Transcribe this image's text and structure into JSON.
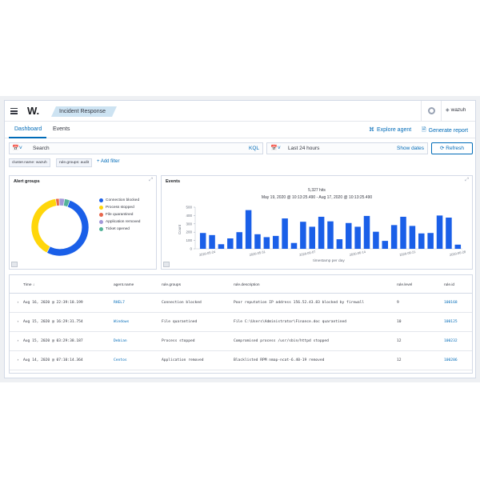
{
  "header": {
    "logo": "W.",
    "breadcrumb": "Incident Response",
    "user": "wazuh"
  },
  "tabs": [
    {
      "label": "Dashboard",
      "active": true
    },
    {
      "label": "Events",
      "active": false
    }
  ],
  "actions": {
    "explore_agent": "Explore agent",
    "generate_report": "Generate report"
  },
  "search": {
    "placeholder": "Search",
    "kql": "KQL"
  },
  "datepicker": {
    "range": "Last 24 hours",
    "show_dates": "Show dates",
    "refresh": "Refresh"
  },
  "filters": {
    "pills": [
      "cluster.name: wazuh",
      "rule.groups: audit"
    ],
    "add_filter": "+ Add filter"
  },
  "alert_groups": {
    "title": "Alert groups",
    "legend": [
      {
        "label": "Connection blocked",
        "color": "#1a5fe8",
        "value": 52
      },
      {
        "label": "Process stopped",
        "color": "#ffd60a",
        "value": 40
      },
      {
        "label": "File quarantined",
        "color": "#e7664c",
        "value": 2
      },
      {
        "label": "Application removed",
        "color": "#a399d8",
        "value": 3
      },
      {
        "label": "Ticket opened",
        "color": "#54b399",
        "value": 3
      }
    ]
  },
  "events": {
    "title": "Events",
    "hits": "5,327 hits",
    "range": "May 19, 2020 @ 10:13:25.490 - Aug 17, 2020 @ 10:13:25.490",
    "ylabel": "Count",
    "xlabel": "timestamp per day"
  },
  "chart_data": {
    "type": "bar",
    "title": "Events",
    "xlabel": "timestamp per day",
    "ylabel": "Count",
    "ylim": [
      0,
      500
    ],
    "yticks": [
      0,
      100,
      200,
      300,
      400,
      500
    ],
    "xticks": [
      "2020-05-24",
      "2020-05-31",
      "2020-06-07",
      "2020-06-14",
      "2020-06-21",
      "2020-06-28",
      "2020-07-05",
      "2020-07-12"
    ],
    "values": [
      190,
      165,
      55,
      125,
      200,
      465,
      175,
      140,
      155,
      365,
      70,
      325,
      265,
      385,
      330,
      115,
      310,
      265,
      395,
      205,
      95,
      285,
      385,
      275,
      185,
      190,
      400,
      375,
      50
    ]
  },
  "table": {
    "headers": [
      "Time ↓",
      "agent.name",
      "rule.groups",
      "rule.description",
      "rule.level",
      "rule.id"
    ],
    "rows": [
      [
        "Aug 16, 2020 @ 22:39:18.199",
        "RHEL7",
        "Connection blocked",
        "Poor reputation IP address 156.52.43.83 blocked by firewall",
        "9",
        "100168"
      ],
      [
        "Aug 15, 2020 @ 16:29:31.754",
        "Windows",
        "File quarantined",
        "File C:\\Users\\Administrator\\Finance.doc quarantined",
        "10",
        "100125"
      ],
      [
        "Aug 15, 2020 @ 03:29:38.187",
        "Debian",
        "Process stopped",
        "Compromised process /usr/sbin/httpd stopped",
        "12",
        "100232"
      ],
      [
        "Aug 14, 2020 @ 07:10:14.364",
        "Centos",
        "Application removed",
        "Blacklisted RPM nmap-ncat-6.40-19 removed",
        "12",
        "100206"
      ]
    ]
  }
}
